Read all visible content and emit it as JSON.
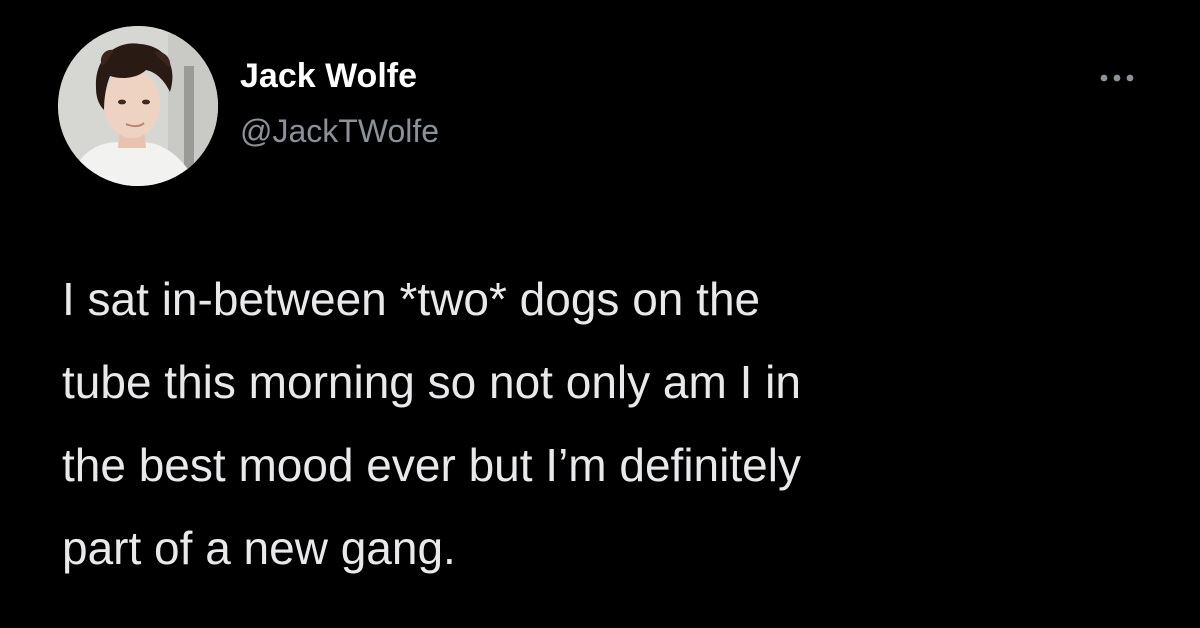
{
  "tweet": {
    "author": {
      "display_name": "Jack Wolfe",
      "handle": "@JackTWolfe",
      "avatar_icon": "profile-photo"
    },
    "more_icon": "more-options-icon",
    "text_lines": [
      "I sat in-between *two* dogs on the",
      "tube this morning so not only am I in",
      "the best mood ever but I’m definitely",
      "part of a new gang."
    ]
  },
  "colors": {
    "background": "#000000",
    "name": "#ffffff",
    "handle": "#8b9198",
    "text": "#e7e9ea"
  }
}
